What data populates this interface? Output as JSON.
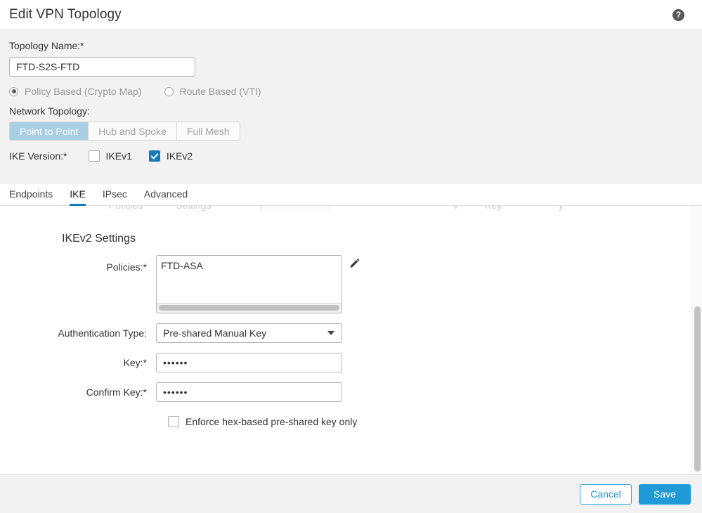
{
  "header": {
    "title": "Edit VPN Topology",
    "help_icon": "help-circle-icon",
    "help_glyph": "?"
  },
  "top_config": {
    "topology_name_label": "Topology Name:*",
    "topology_name_value": "FTD-S2S-FTD",
    "topology_name_placeholder": "",
    "vpn_type_options": [
      {
        "label": "Policy Based (Crypto Map)",
        "selected": true
      },
      {
        "label": "Route Based (VTI)",
        "selected": false
      }
    ],
    "network_topology_label": "Network Topology:",
    "network_topology_options": [
      {
        "label": "Point to Point",
        "active": true
      },
      {
        "label": "Hub and Spoke",
        "active": false
      },
      {
        "label": "Full Mesh",
        "active": false
      }
    ],
    "ike_version_label": "IKE Version:*",
    "ike_versions": [
      {
        "label": "IKEv1",
        "checked": false
      },
      {
        "label": "IKEv2",
        "checked": true
      }
    ]
  },
  "tabs": [
    {
      "label": "Endpoints",
      "active": false
    },
    {
      "label": "IKE",
      "active": true
    },
    {
      "label": "IPsec",
      "active": false
    },
    {
      "label": "Advanced",
      "active": false
    }
  ],
  "main": {
    "section_title": "IKEv2 Settings",
    "policies_label": "Policies:*",
    "policies_items": [
      "FTD-ASA"
    ],
    "edit_icon": "pencil-edit-icon",
    "auth_type_label": "Authentication Type:",
    "auth_type_value": "Pre-shared Manual Key",
    "key_label": "Key:*",
    "key_value": "••••••",
    "confirm_key_label": "Confirm Key:*",
    "confirm_key_value": "••••••",
    "enforce_hex_label": "Enforce hex-based pre-shared key only",
    "enforce_hex_checked": false
  },
  "footer": {
    "cancel_label": "Cancel",
    "save_label": "Save"
  },
  "colors": {
    "accent_blue": "#1f9ad6",
    "tab_underline": "#0f7bbd",
    "checkbox_checked": "#0f7bbd",
    "segment_active": "#a9cfe5",
    "grey_panel": "#f2f2f2"
  }
}
